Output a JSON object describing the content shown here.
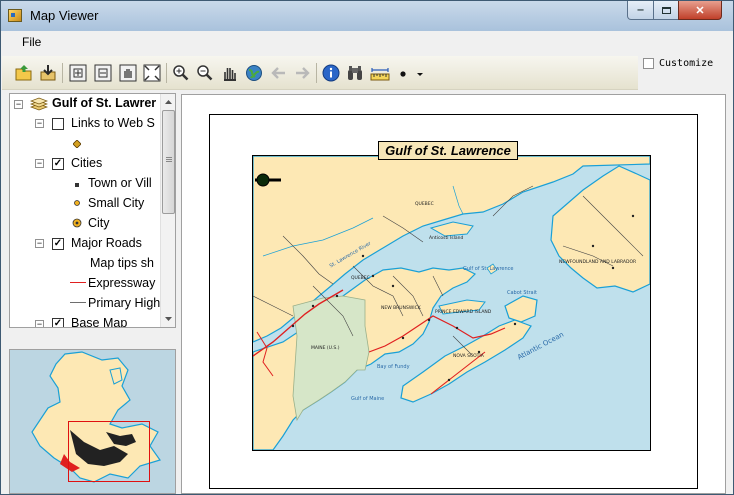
{
  "window": {
    "title": "Map Viewer"
  },
  "menu": {
    "file": "File"
  },
  "toolbar": {
    "buttons": [
      "open-icon",
      "add-data-icon",
      "zoom-in-fixed-icon",
      "zoom-out-fixed-icon",
      "pan-fixed-icon",
      "full-extent-icon",
      "zoom-in-icon",
      "zoom-out-icon",
      "pan-icon",
      "globe-icon",
      "back-arrow-icon",
      "forward-arrow-icon",
      "info-icon",
      "binoculars-icon",
      "measure-icon",
      "point-icon",
      "dropdown-arrow-icon"
    ]
  },
  "customize": {
    "label": "Customize",
    "checked": false
  },
  "toc": {
    "root": "Gulf of St. Lawrence",
    "layers": [
      {
        "name": "Links to Web Sites",
        "checked": false
      },
      {
        "name": "Cities",
        "checked": true,
        "legend": [
          "Town or Village",
          "Small City",
          "City"
        ]
      },
      {
        "name": "Major Roads",
        "checked": true,
        "legend": [
          "Map tips show road name",
          "Expressway",
          "Primary Highway"
        ]
      },
      {
        "name": "Base Map",
        "checked": true
      }
    ]
  },
  "toc_display": {
    "root": "Gulf of St. Lawrer",
    "links": "Links to Web S",
    "cities": "Cities",
    "town": "Town or Vill",
    "small_city": "Small City",
    "city": "City",
    "roads": "Major Roads",
    "maptips": "Map tips sh",
    "expressway": "Expressway",
    "primary": "Primary High",
    "basemap": "Base Map"
  },
  "layout": {
    "map_title": "Gulf of St. Lawrence",
    "labels": {
      "quebec1": "QUEBEC",
      "quebec2": "QUEBEC",
      "newbrunswick": "NEW BRUNSWICK",
      "pei": "PRINCE EDWARD ISLAND",
      "novascotia": "NOVA SCOTIA",
      "maine": "MAINE (U.S.)",
      "newfoundland": "NEWFOUNDLAND AND LABRADOR",
      "gulf": "Gulf of St. Lawrence",
      "cabot": "Cabot Strait",
      "atlantic": "Atlantic Ocean",
      "gulfmaine": "Gulf of Maine",
      "bayfundy": "Bay of Fundy",
      "river": "St. Lawrence River",
      "anticosti": "Anticosti Island"
    }
  },
  "colors": {
    "land": "#fde8b4",
    "us_land": "#d6e6c8",
    "water": "#bfe0ec",
    "coast": "#1aa0d6",
    "expressway": "#e02020",
    "highway": "#6e6e6e",
    "overview_extent": "#e01010"
  }
}
